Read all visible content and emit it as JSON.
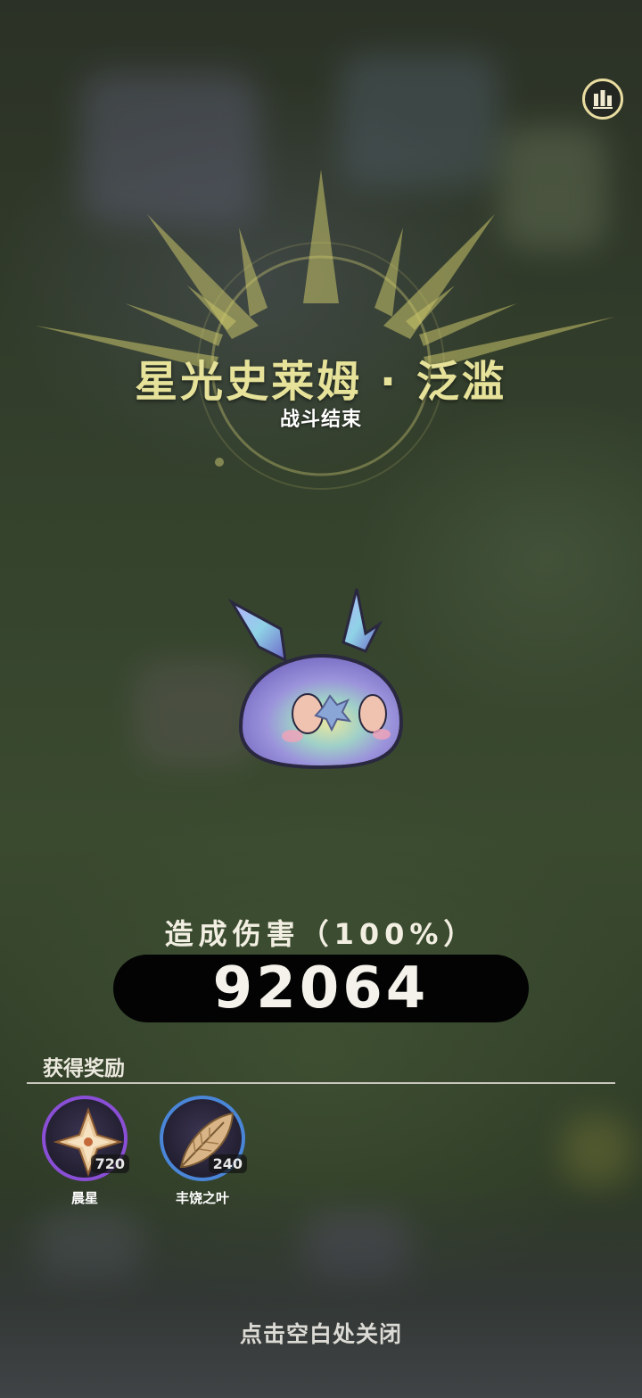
{
  "enemy": {
    "title": "星光史莱姆 · 泛滥",
    "status": "战斗结束"
  },
  "damage": {
    "label": "造成伤害（100%）",
    "value": "92064"
  },
  "rewards": {
    "heading": "获得奖励",
    "items": [
      {
        "name": "晨星",
        "count": "720",
        "icon": "morning-star-icon",
        "ring_color": "#8a4fd6"
      },
      {
        "name": "丰饶之叶",
        "count": "240",
        "icon": "leaf-icon",
        "ring_color": "#4a86d8"
      }
    ]
  },
  "footer": {
    "close_hint": "点击空白处关闭"
  },
  "toolbar": {
    "stats_icon": "bar-chart-icon"
  },
  "colors": {
    "title": "#e6e29a",
    "crown": "#c8c46a"
  }
}
